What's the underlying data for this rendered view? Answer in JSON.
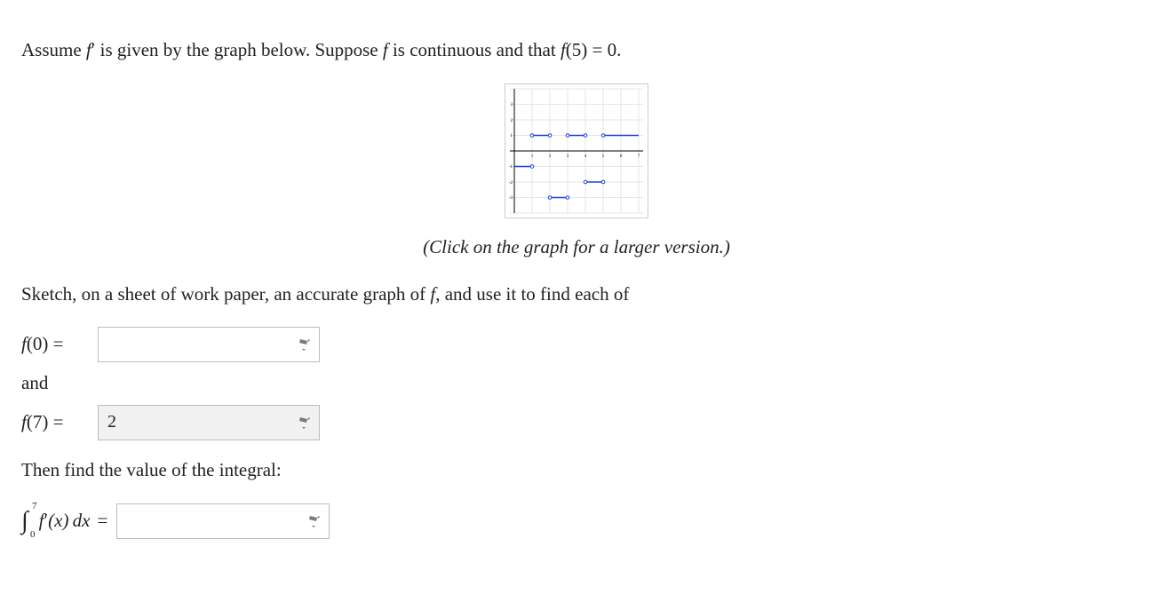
{
  "problem": {
    "intro": "Assume  f′ is given by the graph below. Suppose  f is continuous and that  f(5) = 0.",
    "caption": "(Click on the graph for a larger version.)",
    "sketch_instruction": "Sketch, on a sheet of work paper, an accurate graph of  f, and use it to find each of",
    "and_text": "and",
    "then_text": "Then find the value of the integral:",
    "f0_label_left": "f(0)",
    "f7_label_left": "f(7)",
    "equals": "=",
    "integral_lb": "0",
    "integral_ub": "7",
    "integral_body": "f′(x) dx"
  },
  "answers": {
    "f0": "",
    "f7": "2",
    "integral": ""
  },
  "chart_data": {
    "type": "line",
    "title": "",
    "xlabel": "",
    "ylabel": "",
    "xlim": [
      0,
      7
    ],
    "ylim": [
      -4,
      4
    ],
    "xticks": [
      1,
      2,
      3,
      4,
      5,
      6,
      7
    ],
    "yticks": [
      -3,
      -2,
      -1,
      1,
      2,
      3
    ],
    "series": [
      {
        "name": "segment-0-1",
        "x": [
          0,
          1
        ],
        "y": [
          -1,
          -1
        ]
      },
      {
        "name": "segment-1-2",
        "x": [
          1,
          2
        ],
        "y": [
          1,
          1
        ]
      },
      {
        "name": "segment-2-3",
        "x": [
          2,
          3
        ],
        "y": [
          -3,
          -3
        ]
      },
      {
        "name": "segment-3-4",
        "x": [
          3,
          4
        ],
        "y": [
          1,
          1
        ]
      },
      {
        "name": "segment-4-5",
        "x": [
          4,
          5
        ],
        "y": [
          -2,
          -2
        ]
      },
      {
        "name": "segment-5-6",
        "x": [
          5,
          6
        ],
        "y": [
          1,
          1
        ]
      },
      {
        "name": "segment-6-7",
        "x": [
          6,
          7
        ],
        "y": [
          1,
          1
        ]
      }
    ]
  }
}
